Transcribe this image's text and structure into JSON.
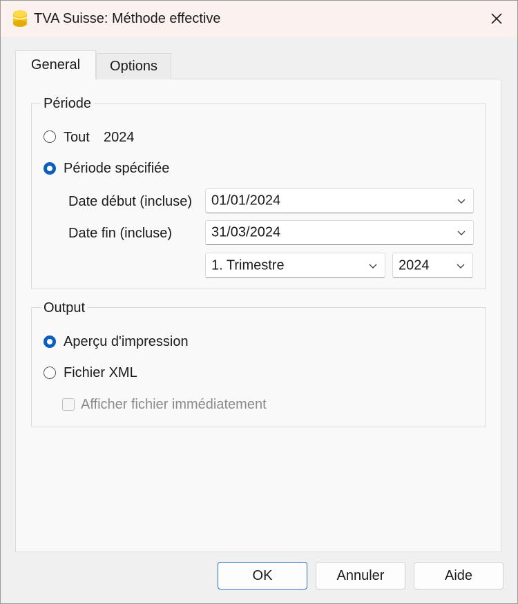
{
  "window": {
    "title": "TVA Suisse: Méthode effective",
    "icon": "app-logo-icon"
  },
  "tabs": [
    {
      "label": "General",
      "active": true
    },
    {
      "label": "Options",
      "active": false
    }
  ],
  "periode": {
    "title": "Période",
    "all_option": {
      "label": "Tout",
      "year": "2024",
      "selected": false
    },
    "specified_option": {
      "label": "Période spécifiée",
      "selected": true
    },
    "start": {
      "label": "Date début (incluse)",
      "value": "01/01/2024"
    },
    "end": {
      "label": "Date fin (incluse)",
      "value": "31/03/2024"
    },
    "period_select": "1. Trimestre",
    "year_select": "2024"
  },
  "output": {
    "title": "Output",
    "print_preview": {
      "label": "Aperçu d'impression",
      "selected": true
    },
    "xml_file": {
      "label": "Fichier XML",
      "selected": false
    },
    "show_file": {
      "label": "Afficher fichier immédiatement",
      "checked": false,
      "enabled": false
    }
  },
  "buttons": {
    "ok": "OK",
    "cancel": "Annuler",
    "help": "Aide"
  },
  "colors": {
    "accent": "#0a5ebd",
    "titlebar": "#fbf1ee",
    "icon": "#f5c518"
  }
}
